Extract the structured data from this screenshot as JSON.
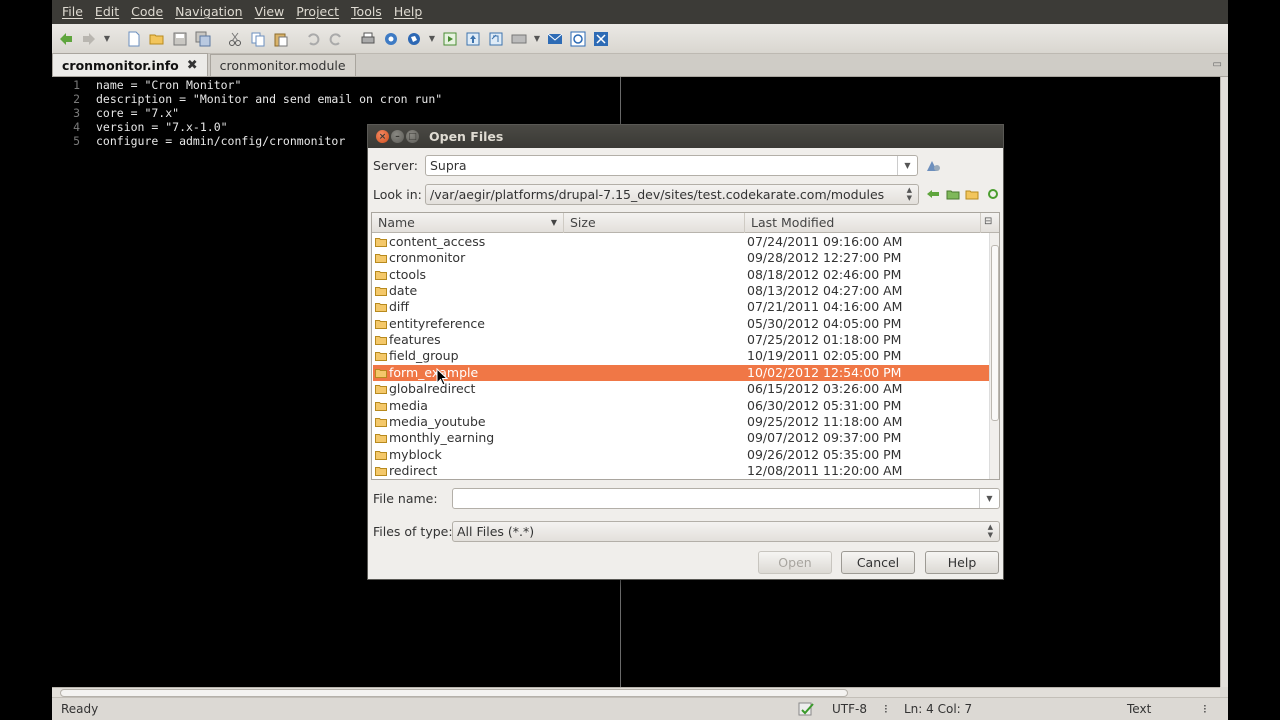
{
  "menu": [
    "File",
    "Edit",
    "Code",
    "Navigation",
    "View",
    "Project",
    "Tools",
    "Help"
  ],
  "tabs": [
    {
      "label": "cronmonitor.info",
      "active": true,
      "close_icon": "✖"
    },
    {
      "label": "cronmonitor.module",
      "active": false
    }
  ],
  "editor": {
    "lines": [
      {
        "num": "1",
        "text": "name = \"Cron Monitor\""
      },
      {
        "num": "2",
        "text": "description = \"Monitor and send email on cron run\""
      },
      {
        "num": "3",
        "text": "core = \"7.x\""
      },
      {
        "num": "4",
        "text": "version = \"7.x-1.0\""
      },
      {
        "num": "5",
        "text": "configure = admin/config/cronmonitor"
      }
    ]
  },
  "statusbar": {
    "state": "Ready",
    "encoding": "UTF-8",
    "position": "Ln: 4 Col: 7",
    "mode": "Text"
  },
  "dialog": {
    "title": "Open Files",
    "server_label": "Server:",
    "server_value": "Supra",
    "lookin_label": "Look in:",
    "lookin_value": "/var/aegir/platforms/drupal-7.15_dev/sites/test.codekarate.com/modules",
    "columns": {
      "name": "Name",
      "size": "Size",
      "modified": "Last Modified"
    },
    "files": [
      {
        "name": "content_access",
        "modified": "07/24/2011 09:16:00 AM"
      },
      {
        "name": "cronmonitor",
        "modified": "09/28/2012 12:27:00 PM"
      },
      {
        "name": "ctools",
        "modified": "08/18/2012 02:46:00 PM"
      },
      {
        "name": "date",
        "modified": "08/13/2012 04:27:00 AM"
      },
      {
        "name": "diff",
        "modified": "07/21/2011 04:16:00 AM"
      },
      {
        "name": "entityreference",
        "modified": "05/30/2012 04:05:00 PM"
      },
      {
        "name": "features",
        "modified": "07/25/2012 01:18:00 PM"
      },
      {
        "name": "field_group",
        "modified": "10/19/2011 02:05:00 PM"
      },
      {
        "name": "form_example",
        "modified": "10/02/2012 12:54:00 PM",
        "selected": true
      },
      {
        "name": "globalredirect",
        "modified": "06/15/2012 03:26:00 AM"
      },
      {
        "name": "media",
        "modified": "06/30/2012 05:31:00 PM"
      },
      {
        "name": "media_youtube",
        "modified": "09/25/2012 11:18:00 AM"
      },
      {
        "name": "monthly_earning",
        "modified": "09/07/2012 09:37:00 PM"
      },
      {
        "name": "myblock",
        "modified": "09/26/2012 05:35:00 PM"
      },
      {
        "name": "redirect",
        "modified": "12/08/2011 11:20:00 AM"
      }
    ],
    "filename_label": "File name:",
    "filename_value": "",
    "filetype_label": "Files of type:",
    "filetype_value": "All Files (*.*)",
    "buttons": {
      "open": "Open",
      "cancel": "Cancel",
      "help": "Help"
    }
  },
  "colors": {
    "selection": "#f07746",
    "menubar": "#3c3b37",
    "editor_bg": "#000000"
  }
}
